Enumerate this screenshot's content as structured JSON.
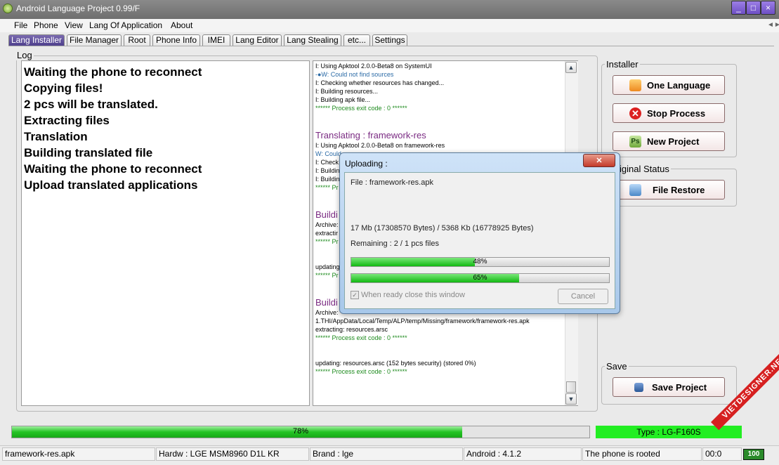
{
  "window": {
    "title": "Android Language Project 0.99/F",
    "min": "_",
    "max": "□",
    "close": "×"
  },
  "menu": {
    "file": "File",
    "phone": "Phone",
    "view": "View",
    "lang": "Lang Of Application",
    "about": "About",
    "scroll_icon": "◄►"
  },
  "tabs": [
    {
      "label": "Lang Installer",
      "active": true
    },
    {
      "label": "File Manager"
    },
    {
      "label": "Root"
    },
    {
      "label": "Phone Info"
    },
    {
      "label": "IMEI"
    },
    {
      "label": "Lang Editor"
    },
    {
      "label": "Lang Stealing"
    },
    {
      "label": "etc..."
    },
    {
      "label": "Settings"
    }
  ],
  "log": {
    "legend": "Log",
    "lines": [
      "Waiting the phone to reconnect",
      "Copying files!",
      "2 pcs will be translated.",
      "Extracting files",
      "Translation",
      "Building translated file",
      "Waiting the phone to reconnect",
      "Upload translated applications"
    ],
    "detail": [
      "I: Using Apktool 2.0.0-Beta8 on SystemUI",
      "-●W: Could not find sources",
      "I: Checking whether resources has changed...",
      "I: Building resources...",
      "I: Building apk file...",
      "****** Process exit code : 0 ******",
      "Translating : framework-res",
      "I: Using Apktool 2.0.0-Beta8 on framework-res",
      "W: Could",
      "I: Check",
      "I: Buildin",
      "I: Buildin",
      "****** Pr",
      "Buildi",
      "Archive:",
      " extractir",
      "****** Pr",
      "updating",
      "****** Pr",
      "Buildi",
      "Archive:",
      "1.THI/AppData/Local/Temp/ALP/temp/Missing/framework/framework-res.apk",
      " extracting: resources.arsc",
      "****** Process exit code : 0 ******",
      "updating: resources.arsc (152 bytes security) (stored 0%)",
      "****** Process exit code : 0 ******"
    ]
  },
  "installer": {
    "legend": "Installer",
    "one": "One Language",
    "stop": "Stop Process",
    "new": "New Project",
    "stop_icon": "✕",
    "new_icon": "Ps"
  },
  "original": {
    "legend": "iginal Status",
    "restore": "File Restore"
  },
  "save": {
    "legend": "Save",
    "button": "Save Project"
  },
  "progress": {
    "main_value": 0.78,
    "main_label": "78%",
    "type_label": "Type : LG-F160S",
    "type_color": "#22ee22"
  },
  "status": {
    "file": "framework-res.apk",
    "hardware": "Hardw : LGE MSM8960 D1L KR",
    "brand": "Brand : lge",
    "android": "Android : 4.1.2",
    "rooted": "The phone is rooted",
    "time": "00:0",
    "battery": "100"
  },
  "watermark": "VIETDESIGNER.NET",
  "dialog": {
    "title": "Uploading :",
    "close": "✕",
    "file": "File : framework-res.apk",
    "size": "17 Mb (17308570 Bytes)  /  5368 Kb (16778925 Bytes)",
    "remaining": "Remaining : 2 /  1 pcs files",
    "progress1": {
      "value": 0.48,
      "label": "48%"
    },
    "progress2": {
      "value": 0.65,
      "label": "65%"
    },
    "checkbox": "When ready close this window",
    "cancel": "Cancel"
  }
}
